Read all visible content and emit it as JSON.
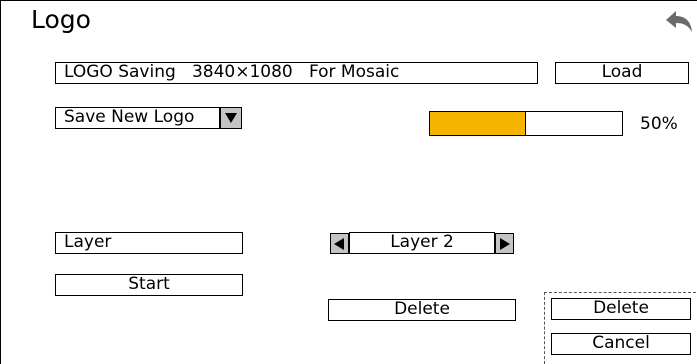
{
  "window": {
    "title": "Logo"
  },
  "header_row": {
    "info_text": "LOGO Saving   3840×1080   For Mosaic",
    "load_label": "Load"
  },
  "mode_select": {
    "value": "Save New Logo"
  },
  "progress": {
    "value": 0.5,
    "label": "50%"
  },
  "layer_row": {
    "label": "Layer",
    "value": "Layer 2"
  },
  "actions": {
    "start_label": "Start",
    "delete_label": "Delete",
    "dialog_delete_label": "Delete",
    "dialog_cancel_label": "Cancel"
  },
  "colors": {
    "progress_fill": "#f5b400",
    "arrow_button_bg": "#c4c4c4",
    "back_icon": "#6b6b6b"
  },
  "icons": {
    "back": "back-arrow-icon",
    "dropdown": "triangle-down-icon",
    "prev": "triangle-left-icon",
    "next": "triangle-right-icon"
  }
}
